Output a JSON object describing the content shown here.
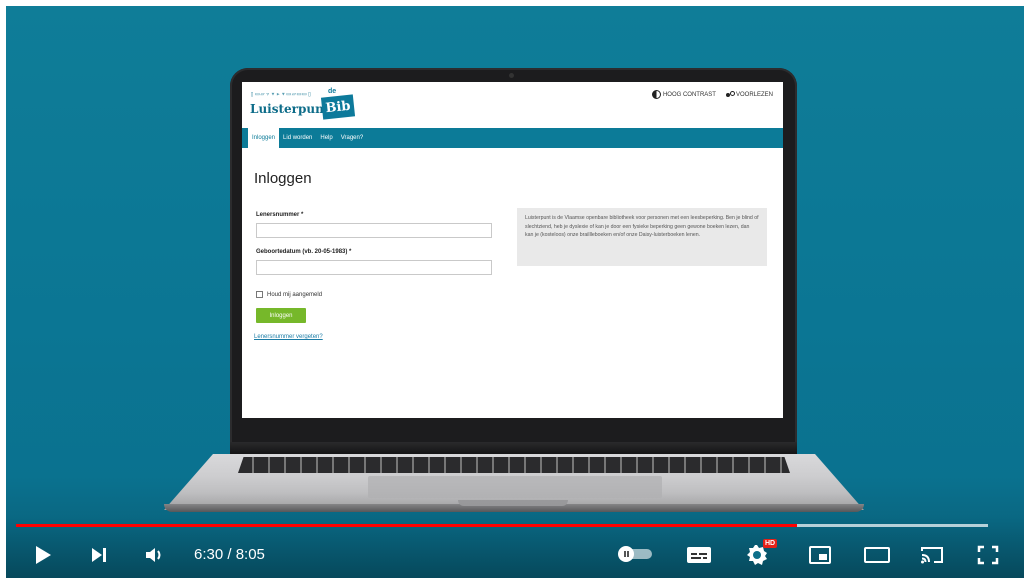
{
  "site": {
    "logo_top": "▯▭▱▿▾▸▾▭▱▭▭▯",
    "logo_main": "Luisterpunt",
    "logo_de": "de",
    "logo_bib": "Bib",
    "tools": {
      "contrast": "HOOG CONTRAST",
      "speak": "VOORLEZEN"
    },
    "nav": [
      "Inloggen",
      "Lid worden",
      "Help",
      "Vragen?"
    ],
    "page_title": "Inloggen",
    "member_label": "Lenersnummer *",
    "birth_label": "Geboortedatum (vb. 20-05-1983) *",
    "remember_label": "Houd mij aangemeld",
    "login_button": "Inloggen",
    "forgot_link": "Lenersnummer vergeten?",
    "info_text": "Luisterpunt is de Vlaamse openbare bibliotheek voor personen met een leesbeperking. Ben je blind of slechtziend, heb je dyslexie of kan je door een fysieke beperking geen gewone boeken lezen, dan kan je (kosteloos) onze braillleboeken en/of onze Daisy-luisterboeken lenen."
  },
  "player": {
    "time_display": "6:30 / 8:05",
    "played_fraction": 0.804,
    "buffered_fraction": 1.0,
    "hd_badge": "HD",
    "icons": [
      "play-icon",
      "next-icon",
      "volume-icon",
      "autoplay-toggle",
      "subtitles-icon",
      "settings-icon",
      "miniplayer-icon",
      "theater-icon",
      "cast-icon",
      "fullscreen-icon"
    ],
    "colors": {
      "progress": "#ff0000",
      "background": "#0b7694",
      "accent": "#76b82a"
    }
  }
}
